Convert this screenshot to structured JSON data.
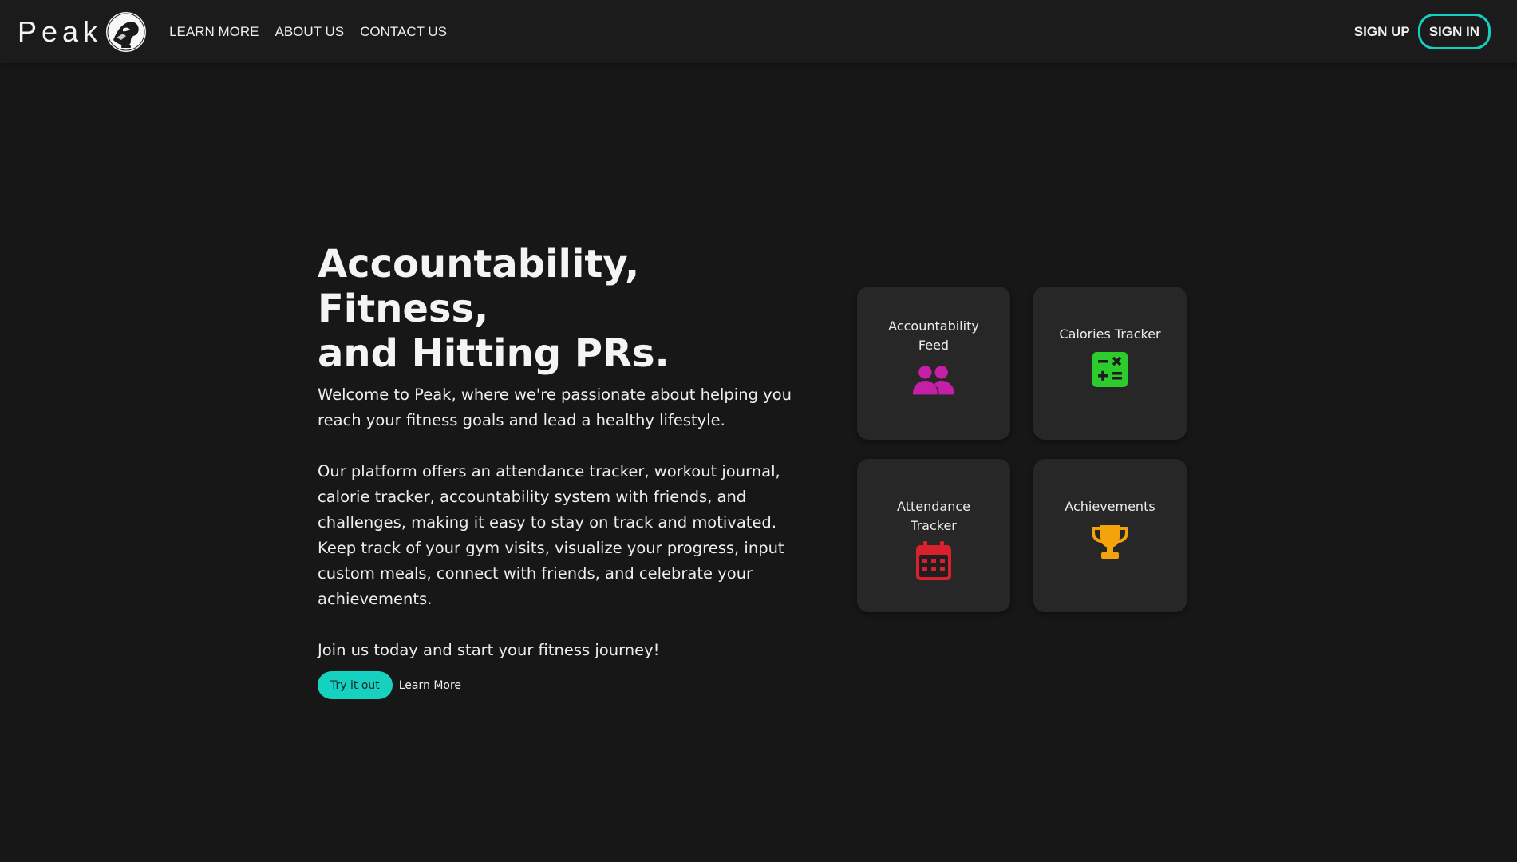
{
  "navbar": {
    "brand": "Peak",
    "links": [
      "LEARN MORE",
      "ABOUT US",
      "CONTACT US"
    ],
    "signup_label": "SIGN UP",
    "signin_label": "SIGN IN",
    "accent_color": "#17cfc0"
  },
  "hero": {
    "title_line1": "Accountability, Fitness,",
    "title_line2": "and Hitting PRs.",
    "intro": "Welcome to Peak, where we're passionate about helping you reach your fitness goals and lead a healthy lifestyle.",
    "description": "Our platform offers an attendance tracker, workout journal, calorie tracker, accountability system with friends, and challenges, making it easy to stay on track and motivated. Keep track of your gym visits, visualize your progress, input custom meals, connect with friends, and celebrate your achievements.",
    "cta_text": "Join us today and start your fitness journey!",
    "try_button": "Try it out",
    "learn_more": "Learn More"
  },
  "features": [
    {
      "label": "Accountability Feed",
      "icon": "users-icon",
      "color": "#c41fa6"
    },
    {
      "label": "Calories Tracker",
      "icon": "calculator-icon",
      "color": "#2ccc2c"
    },
    {
      "label": "Attendance Tracker",
      "icon": "calendar-icon",
      "color": "#d9212e"
    },
    {
      "label": "Achievements",
      "icon": "trophy-icon",
      "color": "#f4a30a"
    }
  ]
}
